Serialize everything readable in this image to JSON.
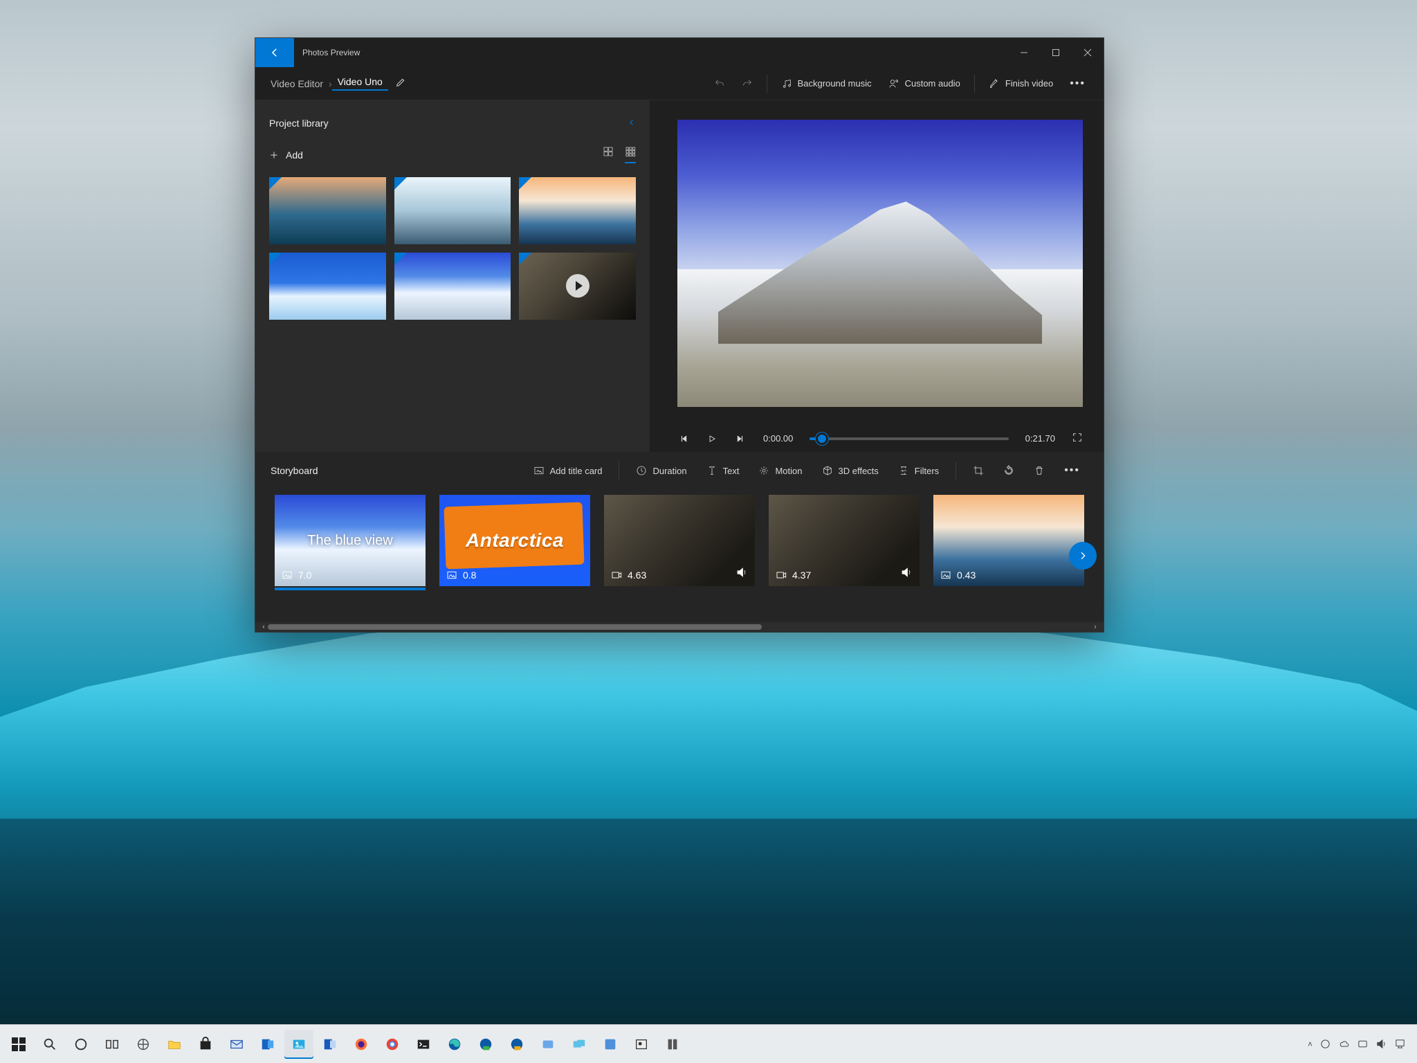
{
  "window": {
    "title": "Photos Preview",
    "breadcrumb": {
      "root": "Video Editor",
      "current": "Video Uno"
    }
  },
  "toolbar": {
    "undo": "Undo",
    "redo": "Redo",
    "bg_music": "Background music",
    "custom_audio": "Custom audio",
    "finish": "Finish video"
  },
  "library": {
    "title": "Project library",
    "add": "Add"
  },
  "transport": {
    "current": "0:00.00",
    "total": "0:21.70"
  },
  "storyboard": {
    "title": "Storyboard",
    "add_title_card": "Add title card",
    "duration": "Duration",
    "text": "Text",
    "motion": "Motion",
    "effects": "3D effects",
    "filters": "Filters",
    "clips": [
      {
        "title": "The blue view",
        "duration": "7.0",
        "kind": "image",
        "audio": false
      },
      {
        "title": "Antarctica",
        "duration": "0.8",
        "kind": "image",
        "audio": false
      },
      {
        "title": "",
        "duration": "4.63",
        "kind": "video",
        "audio": true
      },
      {
        "title": "",
        "duration": "4.37",
        "kind": "video",
        "audio": true
      },
      {
        "title": "",
        "duration": "0.43",
        "kind": "image",
        "audio": false
      }
    ]
  }
}
